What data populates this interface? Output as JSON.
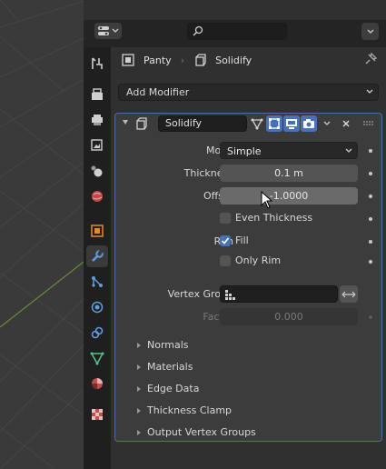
{
  "editor": {
    "search_placeholder": ""
  },
  "breadcrumb": {
    "object": "Panty",
    "modifier": "Solidify"
  },
  "add_modifier": {
    "label": "Add Modifier"
  },
  "modifier": {
    "name": "Solidify",
    "mode": {
      "label": "Mode",
      "value": "Simple"
    },
    "thickness": {
      "label": "Thickness",
      "value": "0.1 m"
    },
    "offset": {
      "label": "Offset",
      "value": "-1.0000"
    },
    "even_thickness": {
      "label": "Even Thickness",
      "checked": false
    },
    "rim": {
      "label": "Rim",
      "fill_label": "Fill",
      "fill_checked": true,
      "only_rim_label": "Only Rim",
      "only_rim_checked": false
    },
    "vertex_group": {
      "label": "Vertex Group",
      "value": ""
    },
    "factor": {
      "label": "Factor",
      "value": "0.000"
    },
    "subpanels": [
      "Normals",
      "Materials",
      "Edge Data",
      "Thickness Clamp",
      "Output Vertex Groups"
    ]
  },
  "colors": {
    "accent": "#4772b3",
    "panel_border": "#4d6fa0",
    "viewport_bg": "#3a3a3a"
  },
  "icons": {
    "tabs": [
      "tool-icon",
      "render-icon",
      "output-icon",
      "view-layer-icon",
      "scene-icon",
      "world-icon",
      "object-icon",
      "modifier-wrench-icon",
      "particles-icon",
      "physics-icon",
      "constraints-icon",
      "data-mesh-icon",
      "material-icon",
      "texture-icon"
    ]
  }
}
